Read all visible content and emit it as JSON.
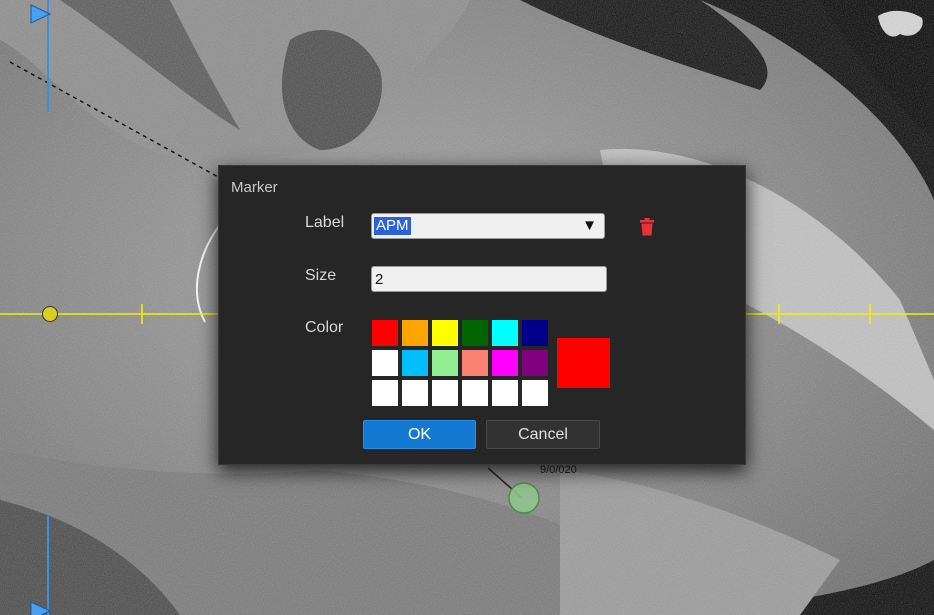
{
  "dialog": {
    "title": "Marker",
    "label_caption": "Label",
    "label_value": "APM",
    "size_caption": "Size",
    "size_value": "2",
    "color_caption": "Color",
    "selected_color": "#ff0000",
    "palette": [
      "#ff0000",
      "#ffa500",
      "#ffff00",
      "#006400",
      "#00ffff",
      "#00008b",
      "#ffffff",
      "#00bfff",
      "#90ee90",
      "#fa8072",
      "#ff00ff",
      "#800080",
      "#ffffff",
      "#ffffff",
      "#ffffff",
      "#ffffff",
      "#ffffff",
      "#ffffff"
    ],
    "ok_label": "OK",
    "cancel_label": "Cancel",
    "delete_icon": "trash-icon"
  },
  "viewer": {
    "crosshair_color": "#f5f000",
    "axis_color": "#3b8fe0",
    "annotation_text": "9/0/020"
  }
}
